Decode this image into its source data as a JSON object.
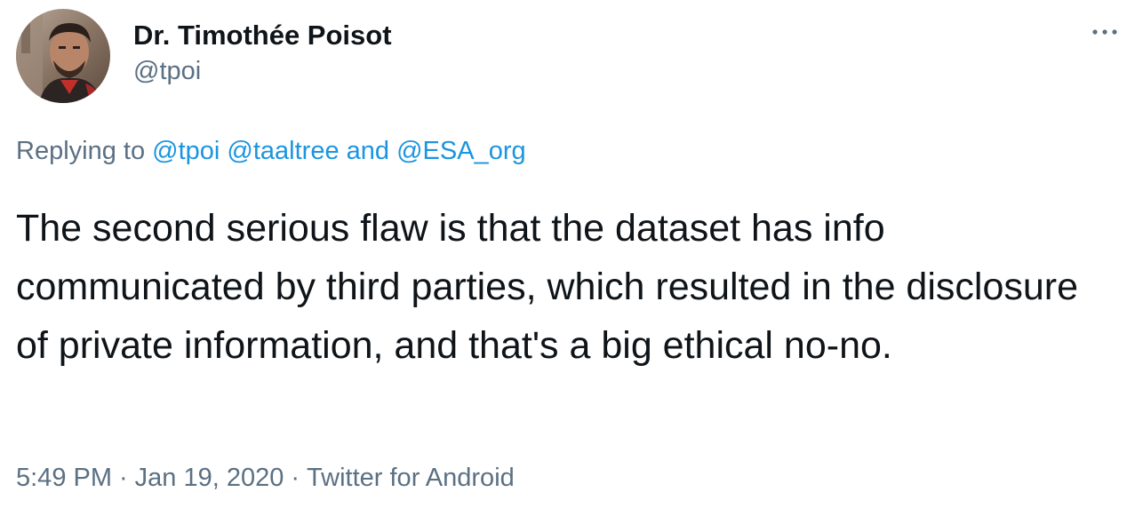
{
  "author": {
    "display_name": "Dr. Timothée Poisot",
    "handle": "@tpoi",
    "avatar_icon": "profile-photo"
  },
  "more_menu": {
    "icon": "more-horizontal-icon"
  },
  "reply_context": {
    "prefix": "Replying to ",
    "mentions": [
      "@tpoi",
      "@taaltree",
      "@ESA_org"
    ],
    "conjunction": " and "
  },
  "tweet": {
    "text": "The second serious flaw is that the dataset has info communicated by third parties, which resulted in the disclosure of private information, and that's a big ethical no-no."
  },
  "meta": {
    "time": "5:49 PM",
    "separator": "·",
    "date": "Jan 19, 2020",
    "source": "Twitter for Android"
  },
  "colors": {
    "text_primary": "#0f1419",
    "text_secondary": "#5b7083",
    "link": "#1b95e0",
    "background": "#ffffff"
  }
}
